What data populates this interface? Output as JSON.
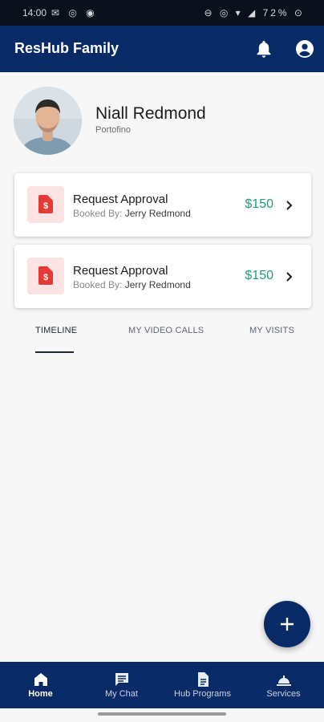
{
  "status_bar": {
    "time": "14:00",
    "left_icons": "✉ ◎ ◉",
    "right_icons": "⊖ ◎ ▾ ◢ 72% ⊙"
  },
  "app_bar": {
    "title": "ResHub Family",
    "icons": [
      "bell-icon",
      "account-circle-icon"
    ]
  },
  "profile": {
    "name": "Niall Redmond",
    "location": "Portofino"
  },
  "approvals": [
    {
      "title": "Request Approval",
      "booked_by_label": "Booked By:",
      "booked_by_name": "Jerry Redmond",
      "amount": "$150",
      "icon": "invoice-dollar-icon"
    },
    {
      "title": "Request Approval",
      "booked_by_label": "Booked By:",
      "booked_by_name": "Jerry Redmond",
      "amount": "$150",
      "icon": "invoice-dollar-icon"
    }
  ],
  "tabs": [
    {
      "label": "TIMELINE",
      "active": true
    },
    {
      "label": "MY VIDEO CALLS",
      "active": false
    },
    {
      "label": "MY VISITS",
      "active": false
    }
  ],
  "fab": {
    "icon": "plus-icon"
  },
  "bottom_nav": [
    {
      "label": "Home",
      "icon": "home-icon",
      "active": true
    },
    {
      "label": "My Chat",
      "icon": "chat-icon",
      "active": false
    },
    {
      "label": "Hub Programs",
      "icon": "document-icon",
      "active": false
    },
    {
      "label": "Services",
      "icon": "service-bell-icon",
      "active": false
    }
  ],
  "colors": {
    "primary": "#082a66",
    "amount": "#1f9e7a",
    "icon_red": "#e53935",
    "icon_tile": "#fbe3e3"
  }
}
